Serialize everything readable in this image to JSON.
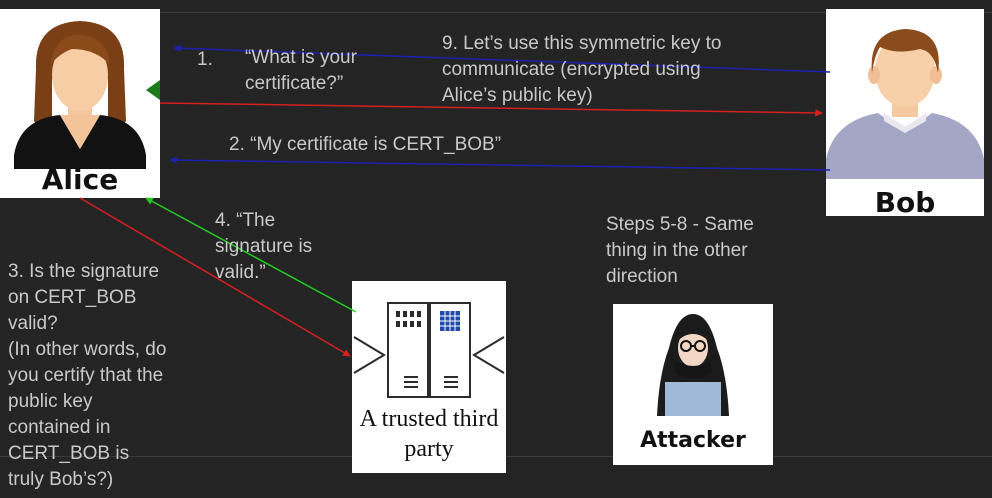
{
  "colors": {
    "background": "#242424",
    "text": "#c9c9c9",
    "arrow_blue": "#1f1fb4",
    "arrow_red": "#d61f1f",
    "arrow_green": "#22cc22"
  },
  "actors": {
    "alice": {
      "label": "Alice",
      "icon": "woman-avatar-icon"
    },
    "bob": {
      "label": "Bob",
      "icon": "man-avatar-icon"
    },
    "third_party": {
      "label_line1": "A trusted third",
      "label_line2": "party",
      "icon": "server-icon"
    },
    "attacker": {
      "label": "Attacker",
      "icon": "hooded-hacker-icon"
    }
  },
  "steps": {
    "step1_num": "1.",
    "step1_text": "“What is your\ncertificate?”",
    "step2": "2. “My certificate is CERT_BOB”",
    "step3": "3. Is the signature\non CERT_BOB\nvalid?\n(In other words, do\nyou certify that the\npublic key\ncontained in\nCERT_BOB is\ntruly Bob’s?)",
    "step4": "4. “The\nsignature is\nvalid.”",
    "step9": "9. Let’s use this symmetric key to\ncommunicate (encrypted using\nAlice’s public key)",
    "steps5_8": "Steps 5-8 - Same\nthing in the other\ndirection"
  }
}
